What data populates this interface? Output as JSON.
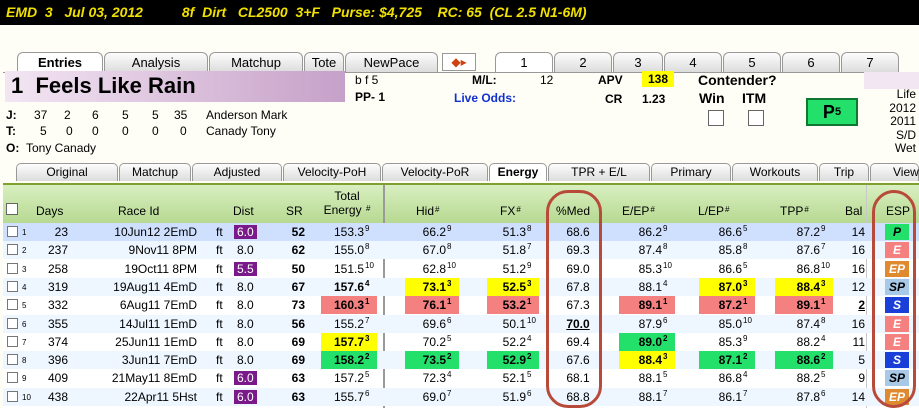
{
  "title_bar": "EMD  3   Jul 03, 2012          8f  Dirt   CL2500  3+F   Purse: $4,725    RC: 65  (CL 2.5 N1-6M)",
  "main_tabs": [
    "Entries",
    "Analysis",
    "Matchup",
    "Tote",
    "NewPace"
  ],
  "horse_tabs": [
    "1",
    "2",
    "3",
    "4",
    "5",
    "6",
    "7"
  ],
  "horse": {
    "number": "1",
    "name": "Feels Like Rain",
    "sex_age": "b f 5",
    "pp": "PP- 1",
    "ml_label": "M/L:",
    "ml_value": "12",
    "live_odds_label": "Live Odds:",
    "apv_label": "APV",
    "apv_value": "138",
    "cr_label": "CR",
    "cr_value": "1.23",
    "contender_label": "Contender?",
    "win_label": "Win",
    "itm_label": "ITM",
    "p_badge": "P",
    "p_badge_sup": "5"
  },
  "connections": {
    "jockey_label": "J:",
    "jockey_stats": [
      "37",
      "2",
      "6",
      "5",
      "5",
      "35"
    ],
    "jockey_name": "Anderson Mark",
    "trainer_label": "T:",
    "trainer_stats": [
      "5",
      "0",
      "0",
      "0",
      "0",
      "0"
    ],
    "trainer_name": "Canady Tony",
    "owner_label": "O:",
    "owner_name": "Tony Canady"
  },
  "life_panel": [
    "Life",
    "2012",
    "2011",
    "S/D",
    "Wet"
  ],
  "sub_tabs": [
    "Original",
    "Matchup",
    "Adjusted",
    "Velocity-PoH",
    "Velocity-PoR",
    "Energy",
    "TPR + E/L",
    "Primary",
    "Workouts",
    "Trip",
    "View"
  ],
  "columns": {
    "days": "Days",
    "race_id": "Race Id",
    "dist": "Dist",
    "sr": "SR",
    "total_energy": [
      "Total",
      "Energy"
    ],
    "hid": "Hid",
    "fx": "FX",
    "pct_med": "%Med",
    "e_ep": "E/EP",
    "l_ep": "L/EP",
    "tpp": "TPP",
    "bal": "Bal",
    "esp": "ESP",
    "hash": "#"
  },
  "rows": [
    {
      "n": "1",
      "days": "23",
      "race": "10Jun12 2EmD",
      "surf": "ft",
      "dist": "6.0",
      "dist_hl": true,
      "sr": "52",
      "te": "153.3",
      "te_r": "9",
      "hid": "66.2",
      "hid_r": "9",
      "fx": "51.3",
      "fx_r": "8",
      "med": "68.6",
      "eep": "86.2",
      "eep_r": "9",
      "lep": "86.6",
      "lep_r": "5",
      "tpp": "87.2",
      "tpp_r": "9",
      "bal": "14",
      "esp": "P"
    },
    {
      "n": "2",
      "days": "237",
      "race": "9Nov11 8PM",
      "surf": "ft",
      "dist": "8.0",
      "sr": "62",
      "te": "155.0",
      "te_r": "8",
      "hid": "67.0",
      "hid_r": "8",
      "fx": "51.8",
      "fx_r": "7",
      "med": "69.3",
      "eep": "87.4",
      "eep_r": "8",
      "lep": "85.8",
      "lep_r": "8",
      "tpp": "87.6",
      "tpp_r": "7",
      "bal": "16",
      "esp": "E"
    },
    {
      "n": "3",
      "days": "258",
      "race": "19Oct11 8PM",
      "surf": "ft",
      "dist": "5.5",
      "dist_hl": true,
      "sr": "50",
      "te": "151.5",
      "te_r": "10",
      "hid": "62.8",
      "hid_r": "10",
      "fx": "51.2",
      "fx_r": "9",
      "med": "69.0",
      "eep": "85.3",
      "eep_r": "10",
      "lep": "86.6",
      "lep_r": "5",
      "tpp": "86.8",
      "tpp_r": "10",
      "bal": "16",
      "esp": "EP"
    },
    {
      "n": "4",
      "days": "319",
      "race": "19Aug11 4EmD",
      "surf": "ft",
      "dist": "8.0",
      "sr": "67",
      "te": "157.6",
      "te_r": "4",
      "te_b": true,
      "hid": "73.1",
      "hid_r": "3",
      "hid_hl": "y",
      "fx": "52.5",
      "fx_r": "3",
      "fx_hl": "y",
      "med": "67.8",
      "eep": "88.1",
      "eep_r": "4",
      "lep": "87.0",
      "lep_r": "3",
      "lep_hl": "y",
      "tpp": "88.4",
      "tpp_r": "3",
      "tpp_hl": "y",
      "bal": "12",
      "esp": "SP"
    },
    {
      "n": "5",
      "days": "332",
      "race": "6Aug11 7EmD",
      "surf": "ft",
      "dist": "8.0",
      "sr": "73",
      "te": "160.3",
      "te_r": "1",
      "te_hl": "r",
      "hid": "76.1",
      "hid_r": "1",
      "hid_hl": "r",
      "fx": "53.2",
      "fx_r": "1",
      "fx_hl": "r",
      "med": "67.3",
      "eep": "89.1",
      "eep_r": "1",
      "eep_hl": "r",
      "lep": "87.2",
      "lep_r": "1",
      "lep_hl": "r",
      "tpp": "89.1",
      "tpp_r": "1",
      "tpp_hl": "r",
      "bal": "2",
      "bal_u": true,
      "esp": "S"
    },
    {
      "n": "6",
      "days": "355",
      "race": "14Jul11 1EmD",
      "surf": "ft",
      "dist": "8.0",
      "sr": "56",
      "te": "155.2",
      "te_r": "7",
      "hid": "69.6",
      "hid_r": "6",
      "fx": "50.1",
      "fx_r": "10",
      "med": "70.0",
      "med_u": true,
      "eep": "87.9",
      "eep_r": "6",
      "lep": "85.0",
      "lep_r": "10",
      "tpp": "87.4",
      "tpp_r": "8",
      "bal": "16",
      "esp": "E"
    },
    {
      "n": "7",
      "days": "374",
      "race": "25Jun11 1EmD",
      "surf": "ft",
      "dist": "8.0",
      "sr": "69",
      "te": "157.7",
      "te_r": "3",
      "te_hl": "y",
      "hid": "70.2",
      "hid_r": "5",
      "fx": "52.2",
      "fx_r": "4",
      "med": "69.4",
      "eep": "89.0",
      "eep_r": "2",
      "eep_hl": "g",
      "lep": "85.3",
      "lep_r": "9",
      "tpp": "88.2",
      "tpp_r": "4",
      "bal": "11",
      "esp": "E"
    },
    {
      "n": "8",
      "days": "396",
      "race": "3Jun11 7EmD",
      "surf": "ft",
      "dist": "8.0",
      "sr": "69",
      "te": "158.2",
      "te_r": "2",
      "te_hl": "g",
      "hid": "73.5",
      "hid_r": "2",
      "hid_hl": "g",
      "fx": "52.9",
      "fx_r": "2",
      "fx_hl": "g",
      "med": "67.6",
      "eep": "88.4",
      "eep_r": "3",
      "eep_hl": "y",
      "lep": "87.1",
      "lep_r": "2",
      "lep_hl": "g",
      "tpp": "88.6",
      "tpp_r": "2",
      "tpp_hl": "g",
      "bal": "5",
      "esp": "S"
    },
    {
      "n": "9",
      "days": "409",
      "race": "21May11 8EmD",
      "surf": "ft",
      "dist": "6.0",
      "dist_hl": true,
      "sr": "63",
      "te": "157.2",
      "te_r": "5",
      "hid": "72.3",
      "hid_r": "4",
      "fx": "52.1",
      "fx_r": "5",
      "med": "68.1",
      "eep": "88.1",
      "eep_r": "5",
      "lep": "86.8",
      "lep_r": "4",
      "tpp": "88.2",
      "tpp_r": "5",
      "bal": "9",
      "esp": "SP"
    },
    {
      "n": "10",
      "days": "438",
      "race": "22Apr11 5Hst",
      "surf": "ft",
      "dist": "6.0",
      "dist_hl": true,
      "sr": "63",
      "te": "155.7",
      "te_r": "6",
      "hid": "69.0",
      "hid_r": "7",
      "fx": "51.9",
      "fx_r": "6",
      "med": "68.8",
      "eep": "88.1",
      "eep_r": "7",
      "lep": "86.1",
      "lep_r": "7",
      "tpp": "87.8",
      "tpp_r": "6",
      "bal": "14",
      "esp": "EP"
    }
  ],
  "colors": {
    "highlight_yellow": "#ffff00",
    "highlight_red": "#f48080",
    "highlight_green": "#22e06a",
    "dist_purple": "#7a1a8a",
    "oval_red": "#b84a3a"
  }
}
